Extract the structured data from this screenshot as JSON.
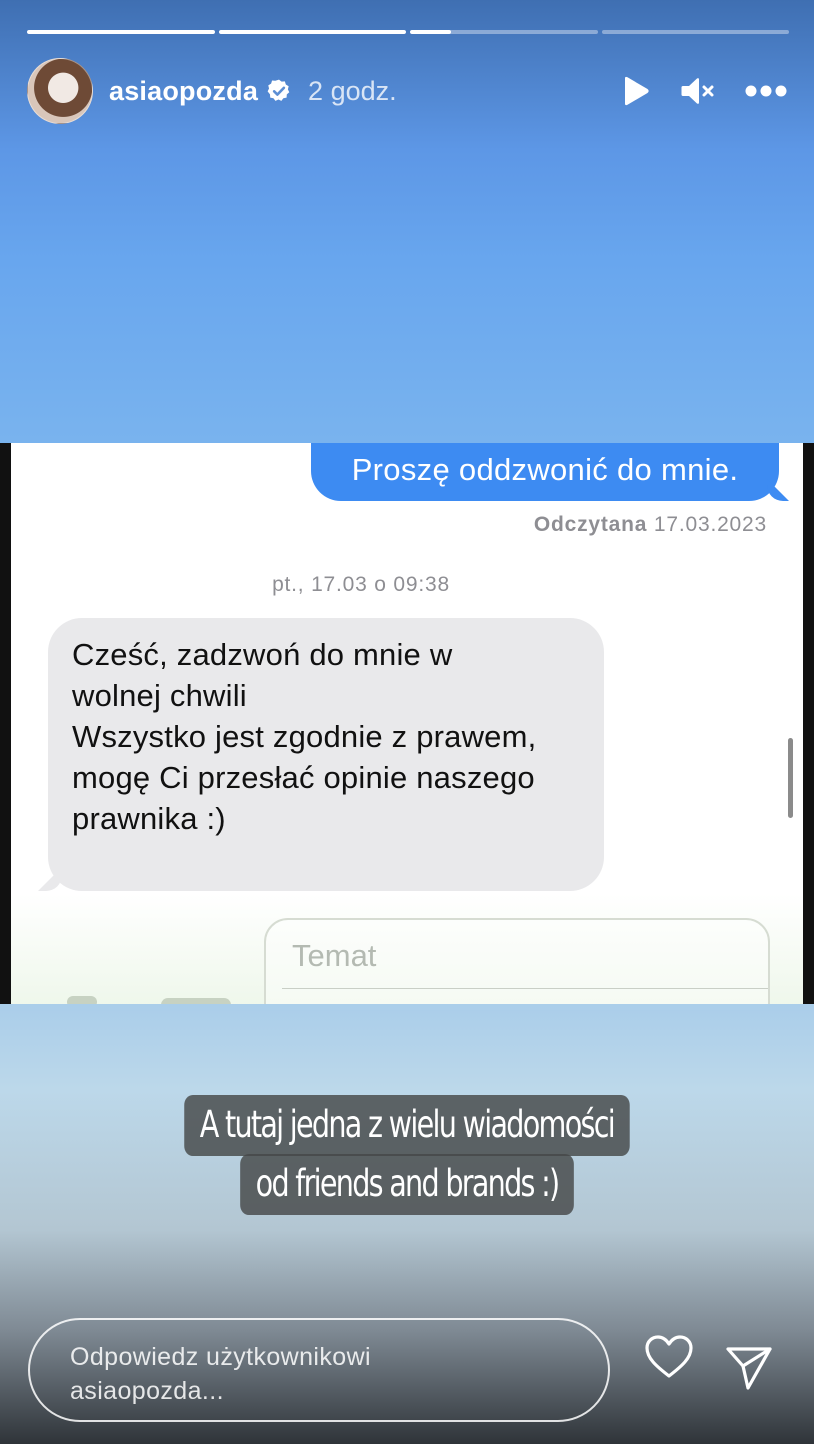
{
  "story": {
    "progress": [
      1.0,
      1.0,
      0.22,
      0.0
    ],
    "username": "asiaopozda",
    "time_ago": "2 godz."
  },
  "chat_screenshot": {
    "outgoing_message": "Proszę oddzwonić do mnie.",
    "read_label": "Odczytana",
    "read_date": "17.03.2023",
    "date_stamp": "pt., 17.03 o 09:38",
    "incoming_message_lines": [
      "Cześć, zadzwoń do mnie w",
      "wolnej chwili",
      "Wszystko jest zgodnie z prawem,",
      "mogę Ci przesłać opinie naszego",
      "prawnika :)"
    ],
    "subject_placeholder": "Temat"
  },
  "caption": {
    "line1": "A tutaj jedna z wielu wiadomości",
    "line2": "od friends and brands :)"
  },
  "reply": {
    "placeholder_line1": "Odpowiedz użytkownikowi",
    "placeholder_line2": "asiaopozda..."
  },
  "icons": {
    "verified": "verified-badge-icon",
    "play": "play-icon",
    "mute": "muted-speaker-icon",
    "more": "more-options-icon",
    "like": "heart-icon",
    "send": "send-icon"
  },
  "colors": {
    "imessage_blue": "#3d8bf2",
    "incoming_grey": "#e9e9eb",
    "sky_blue": "#68a6ee"
  }
}
